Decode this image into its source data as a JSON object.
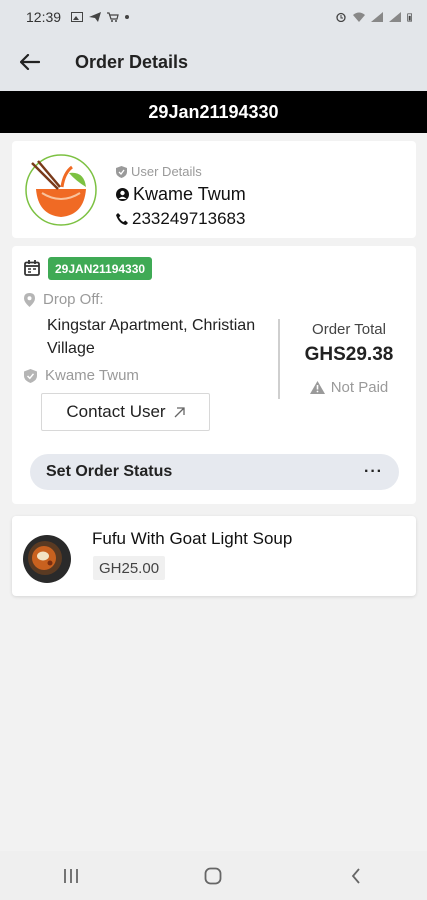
{
  "status_bar": {
    "time": "12:39",
    "left_icons": [
      "image-icon",
      "telegram-icon",
      "cart-icon"
    ],
    "right_icons": [
      "alarm-icon",
      "wifi-icon",
      "signal-icon",
      "signal-icon",
      "battery-icon"
    ]
  },
  "app_bar": {
    "title": "Order Details"
  },
  "banner": {
    "order_id": "29Jan21194330"
  },
  "user_card": {
    "label": "User Details",
    "name": "Kwame Twum",
    "phone": "233249713683"
  },
  "order_card": {
    "badge": "29JAN21194330",
    "drop_off_label": "Drop Off:",
    "address": "Kingstar Apartment, Christian Village",
    "user": "Kwame Twum",
    "contact_button": "Contact User",
    "total_label": "Order Total",
    "total_value": "GHS29.38",
    "payment_status": "Not Paid",
    "set_status_label": "Set Order Status",
    "more_label": "···"
  },
  "items": [
    {
      "name": "Fufu With Goat Light Soup",
      "price": "GH25.00"
    }
  ],
  "colors": {
    "badge_green": "#3faa55",
    "banner_black": "#000000",
    "header_bg": "#e3e6ea",
    "logo_orange": "#f06a24",
    "logo_green": "#7cc142"
  }
}
